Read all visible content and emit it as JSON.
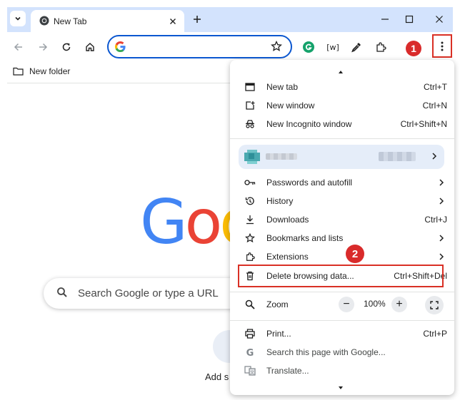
{
  "tab": {
    "title": "New Tab"
  },
  "bookmarks": {
    "folder_label": "New folder"
  },
  "steps": {
    "one": "1",
    "two": "2"
  },
  "ntp": {
    "logo_letters": [
      "G",
      "o",
      "o"
    ],
    "logo_colors": [
      "#4285f4",
      "#ea4335",
      "#fbbc05"
    ],
    "search_placeholder": "Search Google or type a URL",
    "shortcut_label": "Add sh"
  },
  "menu": {
    "items": [
      {
        "label": "New tab",
        "shortcut": "Ctrl+T",
        "icon": "new-tab-icon"
      },
      {
        "label": "New window",
        "shortcut": "Ctrl+N",
        "icon": "new-window-icon"
      },
      {
        "label": "New Incognito window",
        "shortcut": "Ctrl+Shift+N",
        "icon": "incognito-icon"
      },
      {
        "label": "Passwords and autofill",
        "icon": "key-icon"
      },
      {
        "label": "History",
        "icon": "history-icon"
      },
      {
        "label": "Downloads",
        "shortcut": "Ctrl+J",
        "icon": "download-icon"
      },
      {
        "label": "Bookmarks and lists",
        "icon": "star-icon"
      },
      {
        "label": "Extensions",
        "icon": "puzzle-icon"
      },
      {
        "label": "Delete browsing data...",
        "shortcut": "Ctrl+Shift+Del",
        "icon": "trash-icon"
      },
      {
        "label": "Print...",
        "shortcut": "Ctrl+P",
        "icon": "printer-icon"
      },
      {
        "label": "Search this page with Google...",
        "icon": "google-g-icon"
      },
      {
        "label": "Translate...",
        "icon": "translate-icon"
      }
    ],
    "zoom": {
      "label": "Zoom",
      "value": "100%",
      "minus": "−",
      "plus": "+"
    }
  },
  "colors": {
    "accent": "#0b57d0",
    "highlight_red": "#d93025",
    "tabstrip": "#d3e3fd",
    "profile_bg": "#e5edf9"
  }
}
